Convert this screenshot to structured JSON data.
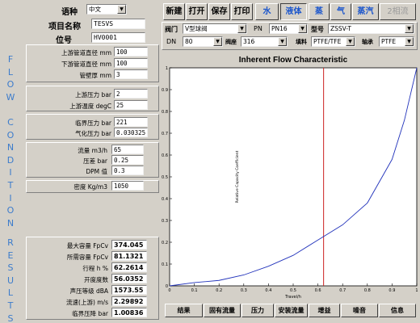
{
  "language": {
    "label": "语种",
    "value": "中文"
  },
  "project": {
    "name_label": "项目名称",
    "name_value": "TESVS",
    "tag_label": "位号",
    "tag_value": "HV0001"
  },
  "flow_condition_title": [
    "F",
    "L",
    "O",
    "W",
    "",
    "C",
    "O",
    "N",
    "D",
    "I",
    "T",
    "I",
    "O",
    "N"
  ],
  "results_title": [
    "R",
    "E",
    "S",
    "U",
    "L",
    "T",
    "S"
  ],
  "pipe": {
    "up_dia_label": "上游管道直径  mm",
    "up_dia": "100",
    "down_dia_label": "下游管道直径  mm",
    "down_dia": "100",
    "wall_label": "管壁厚  mm",
    "wall": "3"
  },
  "upstream": {
    "pressure_label": "上游压力  bar",
    "pressure": "2",
    "temp_label": "上游温度  degC",
    "temp": "25"
  },
  "critical": {
    "crit_label": "临界压力  bar",
    "crit": "221",
    "vapor_label": "气化压力  bar",
    "vapor": "0.030325"
  },
  "flow": {
    "flow_label": "流量  m3/h",
    "flow": "65",
    "dp_label": "压差  bar",
    "dp": "0.25",
    "dpm_label": "DPM 值",
    "dpm": "0.3"
  },
  "density": {
    "label": "密度  Kg/m3",
    "value": "1050"
  },
  "results": [
    {
      "label": "最大容量  FpCv",
      "value": "374.045"
    },
    {
      "label": "所需容量  FpCv",
      "value": "81.1321"
    },
    {
      "label": "行程 h  %",
      "value": "62.2614"
    },
    {
      "label": "开度度数",
      "value": "56.0352"
    },
    {
      "label": "声压等级  dBA",
      "value": "1573.55"
    },
    {
      "label": "流速(上游)  m/s",
      "value": "2.29892"
    },
    {
      "label": "临界压降  bar",
      "value": "1.00836"
    }
  ],
  "toolbar": {
    "new": "新建",
    "open": "打开",
    "save": "保存",
    "print": "打印",
    "water": "水",
    "liquid": "液体",
    "steam": "蒸",
    "gas": "气",
    "vapor": "蒸汽",
    "two_phase": "2相流"
  },
  "valve": {
    "type_label": "阀门",
    "type_value": "V型球阀",
    "pn_label": "PN",
    "pn_value": "PN16",
    "model_label": "型号",
    "model_value": "ZSSV-T",
    "dn_label": "DN",
    "dn_value": "80",
    "body_label": "阀座",
    "body_value": "316",
    "packing_label": "填料",
    "packing_value": "PTFE/TFE",
    "seat_label": "轴承",
    "seat_value": "PTFE"
  },
  "chart_data": {
    "type": "line",
    "title": "Inherent Flow Characteristic",
    "xlabel": "Travel/h",
    "ylabel": "Relative Capacity Coefficient",
    "xlim": [
      0,
      1
    ],
    "ylim": [
      0,
      1
    ],
    "x_ticks": [
      "0",
      "0.1",
      "0.2",
      "0.3",
      "0.4",
      "0.5",
      "0.6",
      "0.7",
      "0.8",
      "0.9",
      "1"
    ],
    "y_ticks": [
      "0",
      "0.1",
      "0.2",
      "0.3",
      "0.4",
      "0.5",
      "0.6",
      "0.7",
      "0.8",
      "0.9",
      "1"
    ],
    "series": [
      {
        "x": [
          0,
          0.1,
          0.2,
          0.3,
          0.4,
          0.5,
          0.6,
          0.7,
          0.8,
          0.9,
          0.95,
          1.0
        ],
        "y": [
          0,
          0.015,
          0.025,
          0.05,
          0.09,
          0.14,
          0.21,
          0.28,
          0.38,
          0.58,
          0.76,
          1.0
        ],
        "color": "#2233bb"
      }
    ],
    "marker_x": 0.623,
    "marker_color": "#cc2222"
  },
  "bottom_tabs": {
    "results": "结果",
    "inherent": "固有流量",
    "pressure": "压力",
    "install": "安装流量",
    "gain": "增益",
    "noise": "噪音",
    "info": "信息"
  }
}
